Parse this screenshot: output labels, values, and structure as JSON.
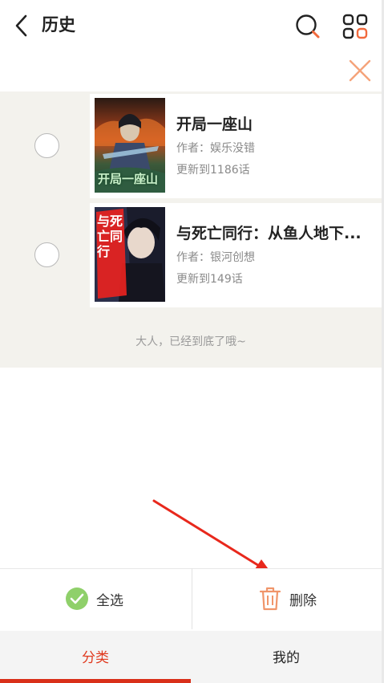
{
  "header": {
    "title": "历史",
    "icons": [
      "back-arrow-icon",
      "search-icon",
      "grid-menu-icon"
    ],
    "accent": "#f26a3d"
  },
  "edit_bar": {
    "close_icon": "close-icon",
    "close_color": "#f5a37a"
  },
  "books": [
    {
      "title": "开局一座山",
      "author": "作者：娱乐没错",
      "update": "更新到1186话",
      "cover_text": "开局一座山"
    },
    {
      "title": "与死亡同行：从鱼人地下...",
      "author": "作者：银河创想",
      "update": "更新到149话",
      "cover_text": "与死亡同行"
    }
  ],
  "list_footer": "大人，已经到底了哦~",
  "actions": {
    "select_all": "全选",
    "delete": "删除"
  },
  "tabs": [
    {
      "label": "分类",
      "active": true
    },
    {
      "label": "我的",
      "active": false
    }
  ],
  "colors": {
    "list_bg": "#f3f2ed",
    "active_tab": "#e0391e",
    "check_green": "#8fd06a",
    "trash_orange": "#f0956a",
    "annotation_arrow": "#e8281c"
  }
}
